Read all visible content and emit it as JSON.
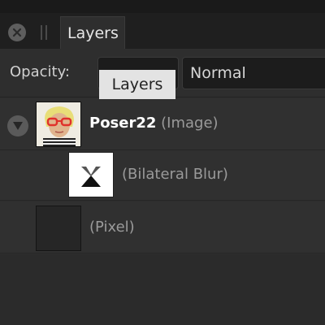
{
  "panel": {
    "tab_label": "Layers",
    "close_icon": "close-icon",
    "grip_icon": "drag-grip-icon"
  },
  "options": {
    "opacity_label": "Opacity:",
    "opacity_value": "",
    "blend_mode": "Normal"
  },
  "tooltip": {
    "text": "Layers"
  },
  "layers": [
    {
      "name": "Poser22",
      "type": "(Image)",
      "expanded": true,
      "thumbnail": "portrait-photo"
    },
    {
      "name": "",
      "type": "(Bilateral Blur)",
      "thumbnail": "filter-hourglass-icon"
    },
    {
      "name": "",
      "type": "(Pixel)",
      "thumbnail": "empty-pixel"
    }
  ],
  "colors": {
    "panel_bg": "#2e2e2e",
    "tab_strip_bg": "#1f1f1f",
    "tooltip_bg": "#e3e3e3",
    "field_bg": "#1c1c1c"
  }
}
